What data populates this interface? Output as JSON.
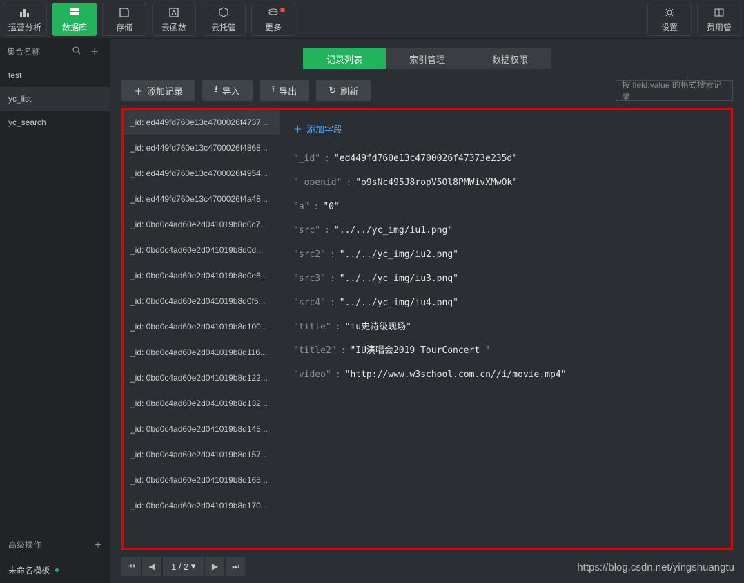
{
  "top": {
    "items": [
      "运营分析",
      "数据库",
      "存储",
      "云函数",
      "云托管",
      "更多"
    ],
    "right": [
      "设置",
      "费用管"
    ]
  },
  "sidebar": {
    "head": "集合名称",
    "items": [
      "test",
      "yc_list",
      "yc_search"
    ],
    "selected_index": 1,
    "section": "高级操作",
    "template": "未命名模板"
  },
  "tabs": {
    "items": [
      "记录列表",
      "索引管理",
      "数据权限"
    ],
    "active_index": 0
  },
  "toolbar": {
    "add": "添加记录",
    "import": "导入",
    "export": "导出",
    "refresh": "刷新",
    "search_placeholder": "按 field:value 的格式搜索记录"
  },
  "add_field": "添加字段",
  "records": [
    "_id: ed449fd760e13c4700026f4737...",
    "_id: ed449fd760e13c4700026f4868...",
    "_id: ed449fd760e13c4700026f4954...",
    "_id: ed449fd760e13c4700026f4a48...",
    "_id: 0bd0c4ad60e2d041019b8d0c7...",
    "_id: 0bd0c4ad60e2d041019b8d0d...",
    "_id: 0bd0c4ad60e2d041019b8d0e6...",
    "_id: 0bd0c4ad60e2d041019b8d0f5...",
    "_id: 0bd0c4ad60e2d041019b8d100...",
    "_id: 0bd0c4ad60e2d041019b8d116...",
    "_id: 0bd0c4ad60e2d041019b8d122...",
    "_id: 0bd0c4ad60e2d041019b8d132...",
    "_id: 0bd0c4ad60e2d041019b8d145...",
    "_id: 0bd0c4ad60e2d041019b8d157...",
    "_id: 0bd0c4ad60e2d041019b8d165...",
    "_id: 0bd0c4ad60e2d041019b8d170..."
  ],
  "detail": [
    {
      "k": "_id",
      "v": "ed449fd760e13c4700026f47373e235d"
    },
    {
      "k": "_openid",
      "v": "o9sNc495J8ropV5Ol8PMWivXMwOk"
    },
    {
      "k": "a",
      "v": "0"
    },
    {
      "k": "src",
      "v": "../../yc_img/iu1.png"
    },
    {
      "k": "src2",
      "v": "../../yc_img/iu2.png"
    },
    {
      "k": "src3",
      "v": "../../yc_img/iu3.png"
    },
    {
      "k": "src4",
      "v": "../../yc_img/iu4.png"
    },
    {
      "k": "title",
      "v": "iu史诗级现场"
    },
    {
      "k": "title2",
      "v": "IU演唱会2019 TourConcert "
    },
    {
      "k": "video",
      "v": "http://www.w3school.com.cn//i/movie.mp4"
    }
  ],
  "pager": {
    "text": "1 / 2",
    "dropdown": "▾"
  },
  "watermark": "https://blog.csdn.net/yingshuangtu"
}
